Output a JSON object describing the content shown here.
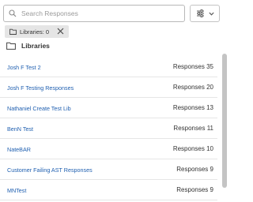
{
  "search": {
    "placeholder": "Search Responses",
    "value": ""
  },
  "filter": {
    "icon": "filter-sliders-icon",
    "chevron": "chevron-down-icon"
  },
  "chip": {
    "label": "Libraries: 0",
    "close_icon": "close-icon"
  },
  "section": {
    "title": "Libraries",
    "icon": "folder-icon"
  },
  "libraries": [
    {
      "name": "Josh F Test 2",
      "count_label": "Responses",
      "count": "35"
    },
    {
      "name": "Josh F Testing Responses",
      "count_label": "Responses",
      "count": "20"
    },
    {
      "name": "Nathaniel Create Test Lib",
      "count_label": "Responses",
      "count": "13"
    },
    {
      "name": "BenN Test",
      "count_label": "Responses",
      "count": "11"
    },
    {
      "name": "NateBAR",
      "count_label": "Responses",
      "count": "10"
    },
    {
      "name": "Customer Failing AST Responses",
      "count_label": "Responses",
      "count": "9"
    },
    {
      "name": "MNTest",
      "count_label": "Responses",
      "count": "9"
    }
  ],
  "colors": {
    "link": "#1f5fb0",
    "chip_bg": "#e5e5e5",
    "divider": "#e6e6e6",
    "scroll_thumb": "#c4c4c4"
  }
}
